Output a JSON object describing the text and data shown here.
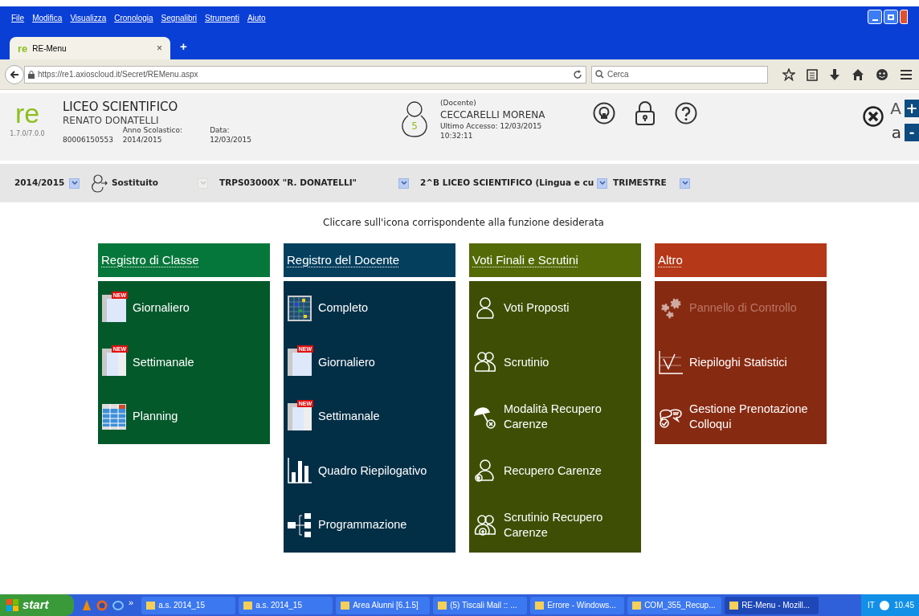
{
  "menu_bar": [
    "File",
    "Modifica",
    "Visualizza",
    "Cronologia",
    "Segnalibri",
    "Strumenti",
    "Aiuto"
  ],
  "tab": {
    "logo": "re",
    "title": "RE-Menu",
    "close": "×",
    "new_tab": "+"
  },
  "address_bar": {
    "url": "https://re1.axioscloud.it/Secret/REMenu.aspx",
    "search_placeholder": "Cerca"
  },
  "header": {
    "logo": "re",
    "version": "1.7.0/7.0.0",
    "school": "LICEO SCIENTIFICO",
    "school_name": "RENATO DONATELLI",
    "code": "80006150553",
    "year_label": "Anno Scolastico:",
    "year": "2014/2015",
    "date_label": "Data:",
    "date": "12/03/2015",
    "avatar_number": "5",
    "role": "(Docente)",
    "user": "CECCARELLI MORENA",
    "last_access": "Ultimo Accesso: 12/03/2015 10:32:11",
    "font_plus_label": "A",
    "font_plus": "+",
    "font_minus_label": "a",
    "font_minus": "-"
  },
  "filters": [
    {
      "kind": "select",
      "value": "2014/2015",
      "disabled": false
    },
    {
      "kind": "substitute",
      "value": "Sostituito",
      "disabled": true
    },
    {
      "kind": "select",
      "value": "TRPS03000X \"R. DONATELLI\"",
      "disabled": false
    },
    {
      "kind": "select",
      "value": "2^B LICEO SCIENTIFICO (Lingua e cu",
      "disabled": false
    },
    {
      "kind": "select",
      "value": "TRIMESTRE",
      "disabled": false
    }
  ],
  "instruction": "Cliccare sull'icona corrispondente alla funzione desiderata",
  "sections": [
    {
      "title": "Registro di Classe",
      "color": "#06773a",
      "items": [
        {
          "label": "Giornaliero",
          "kind": "sheet",
          "badge": "NEW",
          "disabled": false
        },
        {
          "label": "Settimanale",
          "kind": "week",
          "badge": "NEW",
          "disabled": false
        },
        {
          "label": "Planning",
          "kind": "planning",
          "disabled": false
        }
      ]
    },
    {
      "title": "Registro del Docente",
      "color": "#043f5e",
      "items": [
        {
          "label": "Completo",
          "kind": "grid",
          "disabled": false
        },
        {
          "label": "Giornaliero",
          "kind": "sheet",
          "badge": "NEW",
          "disabled": false
        },
        {
          "label": "Settimanale",
          "kind": "week",
          "badge": "NEW",
          "disabled": false
        },
        {
          "label": "Quadro Riepilogativo",
          "kind": "bars",
          "disabled": false
        },
        {
          "label": "Programmazione",
          "kind": "tree",
          "disabled": false
        }
      ]
    },
    {
      "title": "Voti Finali e Scrutini",
      "color": "#536a07",
      "items": [
        {
          "label": "Voti Proposti",
          "kind": "person",
          "disabled": false
        },
        {
          "label": "Scrutinio",
          "kind": "people",
          "disabled": false
        },
        {
          "label": "Modalità Recupero Carenze",
          "kind": "umbrella",
          "disabled": false
        },
        {
          "label": "Recupero Carenze",
          "kind": "person-plus",
          "disabled": false
        },
        {
          "label": "Scrutinio Recupero Carenze",
          "kind": "people-plus",
          "disabled": false
        }
      ]
    },
    {
      "title": "Altro",
      "color": "#b53818",
      "items": [
        {
          "label": "Pannello di Controllo",
          "kind": "gears",
          "disabled": true
        },
        {
          "label": "Riepiloghi Statistici",
          "kind": "stats",
          "disabled": false
        },
        {
          "label": "Gestione Prenotazione Colloqui",
          "kind": "chat",
          "disabled": false
        }
      ]
    }
  ],
  "taskbar": {
    "start": "start",
    "more": "»",
    "items": [
      "a.s. 2014_15",
      "a.s. 2014_15",
      "Area Alunni [6.1.5]",
      "(5) Tiscali Mail :: ...",
      "Errore - Windows...",
      "COM_355_Recup...",
      "RE-Menu - Mozill..."
    ],
    "language": "IT",
    "clock": "10.45"
  }
}
